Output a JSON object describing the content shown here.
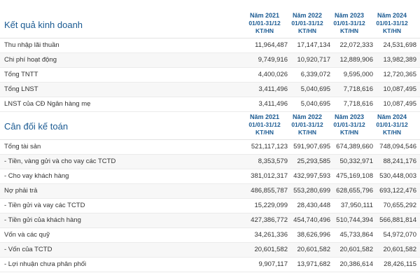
{
  "sections": [
    {
      "title": "Kết quả kinh doanh",
      "columns": [
        {
          "year": "Năm 2021",
          "period": "01/01-31/12",
          "type": "KT/HN"
        },
        {
          "year": "Năm 2022",
          "period": "01/01-31/12",
          "type": "KT/HN"
        },
        {
          "year": "Năm 2023",
          "period": "01/01-31/12",
          "type": "KT/HN"
        },
        {
          "year": "Năm 2024",
          "period": "01/01-31/12",
          "type": "KT/HN"
        }
      ],
      "rows": [
        {
          "label": "Thu nhập lãi thuần",
          "values": [
            "11,964,487",
            "17,147,134",
            "22,072,333",
            "24,531,698"
          ]
        },
        {
          "label": "Chi phí hoạt động",
          "values": [
            "9,749,916",
            "10,920,717",
            "12,889,906",
            "13,982,389"
          ]
        },
        {
          "label": "Tổng TNTT",
          "values": [
            "4,400,026",
            "6,339,072",
            "9,595,000",
            "12,720,365"
          ]
        },
        {
          "label": "Tổng LNST",
          "values": [
            "3,411,496",
            "5,040,695",
            "7,718,616",
            "10,087,495"
          ]
        },
        {
          "label": "LNST của CĐ Ngân hàng mẹ",
          "values": [
            "3,411,496",
            "5,040,695",
            "7,718,616",
            "10,087,495"
          ]
        }
      ]
    },
    {
      "title": "Cân đối kế toán",
      "columns": [
        {
          "year": "Năm 2021",
          "period": "01/01-31/12",
          "type": "KT/HN"
        },
        {
          "year": "Năm 2022",
          "period": "01/01-31/12",
          "type": "KT/HN"
        },
        {
          "year": "Năm 2023",
          "period": "01/01-31/12",
          "type": "KT/HN"
        },
        {
          "year": "Năm 2024",
          "period": "01/01-31/12",
          "type": "KT/HN"
        }
      ],
      "rows": [
        {
          "label": "Tổng tài sản",
          "values": [
            "521,117,123",
            "591,907,695",
            "674,389,660",
            "748,094,546"
          ]
        },
        {
          "label": "- Tiền, vàng gửi và cho vay các TCTD",
          "values": [
            "8,353,579",
            "25,293,585",
            "50,332,971",
            "88,241,176"
          ]
        },
        {
          "label": "- Cho vay khách hàng",
          "values": [
            "381,012,317",
            "432,997,593",
            "475,169,108",
            "530,448,003"
          ]
        },
        {
          "label": "Nợ phải trả",
          "values": [
            "486,855,787",
            "553,280,699",
            "628,655,796",
            "693,122,476"
          ]
        },
        {
          "label": "- Tiền gửi và vay các TCTD",
          "values": [
            "15,229,099",
            "28,430,448",
            "37,950,111",
            "70,655,292"
          ]
        },
        {
          "label": "- Tiền gửi của khách hàng",
          "values": [
            "427,386,772",
            "454,740,496",
            "510,744,394",
            "566,881,814"
          ]
        },
        {
          "label": "Vốn và các quỹ",
          "values": [
            "34,261,336",
            "38,626,996",
            "45,733,864",
            "54,972,070"
          ]
        },
        {
          "label": "- Vốn của TCTD",
          "values": [
            "20,601,582",
            "20,601,582",
            "20,601,582",
            "20,601,582"
          ]
        },
        {
          "label": "- Lợi nhuận chưa phân phối",
          "values": [
            "9,907,117",
            "13,971,682",
            "20,386,614",
            "28,426,115"
          ]
        }
      ]
    }
  ]
}
